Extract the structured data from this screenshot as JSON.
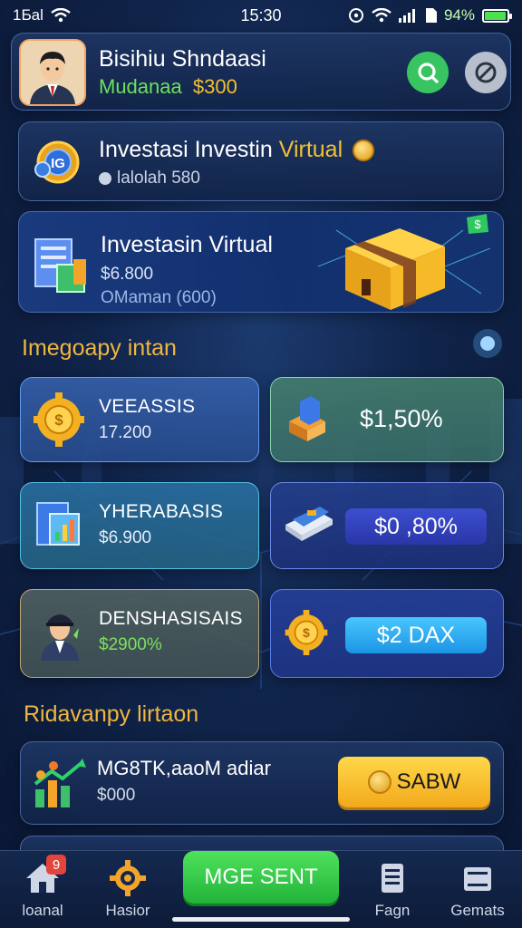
{
  "status_bar": {
    "carrier": "1Ƃal",
    "time": "15:30",
    "battery": "94%",
    "battery_level": 0.94
  },
  "profile": {
    "name": "Bisihiu Shndaasi",
    "sub_label": "Mudanaa",
    "sub_amount": "$300"
  },
  "invest_card": {
    "title_white": "Investasi Investin",
    "title_gold": "Virtual",
    "subtitle": "lalolah 580"
  },
  "banner": {
    "title": "Investasin Virtual",
    "value": "$6.800",
    "value2": "OMaman (600)"
  },
  "section1_title": "Imegoapy intan",
  "grid": [
    {
      "title": "VEEASSIS",
      "value": "17.200"
    },
    {
      "big": "$1,50%"
    },
    {
      "title": "YHERABASIS",
      "value": "$6.900"
    },
    {
      "pill": "$0 ,80%"
    },
    {
      "title": "DENSHASISAIS",
      "value": "$2900%"
    },
    {
      "pill": "$2  DAX"
    }
  ],
  "section2_title": "Ridavanpy lirtaon",
  "reward": {
    "title": "MG8TK,aaoM adiar",
    "subtitle": "$000",
    "button": "SABW"
  },
  "bottom_nav": {
    "home_label": "loanal",
    "home_badge": "9",
    "hasior_label": "Hasior",
    "cta": "MGE SENT",
    "fagn_label": "Fagn",
    "gemats_label": "Gemats"
  },
  "colors": {
    "gold": "#f2c032",
    "green": "#6ee05c",
    "cta_green": "#22b33a",
    "accent_blue": "#2a36a8"
  }
}
